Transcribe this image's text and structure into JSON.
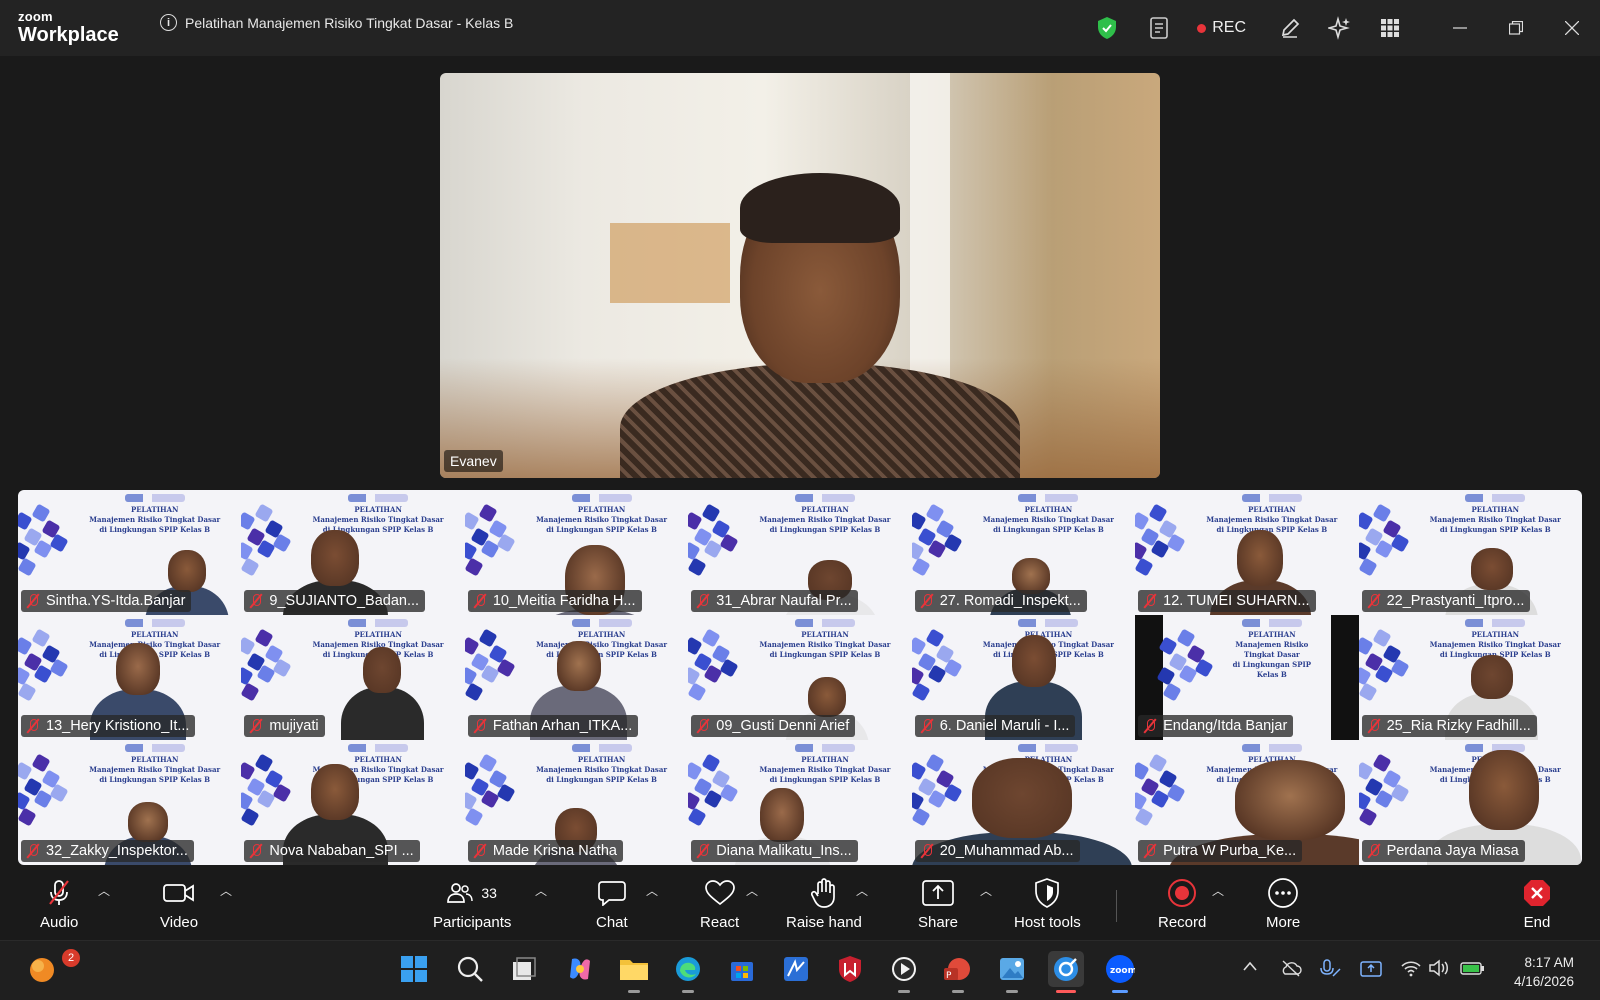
{
  "app": {
    "logo_line1": "zoom",
    "logo_line2": "Workplace",
    "meeting_title": "Pelatihan Manajemen Risiko Tingkat Dasar - Kelas B",
    "rec_label": "REC"
  },
  "speaker": {
    "name": "Evanev"
  },
  "banner": {
    "line1": "PELATIHAN",
    "line2": "Manajemen Risiko Tingkat Dasar",
    "line3": "di Lingkungan SPIP Kelas B"
  },
  "gallery": [
    {
      "name": "Sintha.YS-Itda.Banjar"
    },
    {
      "name": "9_SUJIANTO_Badan..."
    },
    {
      "name": "10_Meitia Faridha H..."
    },
    {
      "name": "31_Abrar Naufal Pr..."
    },
    {
      "name": "27. Romadi_Inspekt..."
    },
    {
      "name": "12. TUMEI SUHARN..."
    },
    {
      "name": "22_Prastyanti_Itpro..."
    },
    {
      "name": "13_Hery Kristiono_It..."
    },
    {
      "name": "mujiyati"
    },
    {
      "name": "Fathan Arhan_ITKA..."
    },
    {
      "name": "09_Gusti Denni Arief"
    },
    {
      "name": "6. Daniel Maruli - I..."
    },
    {
      "name": "Endang/Itda Banjar"
    },
    {
      "name": "25_Ria Rizky Fadhill..."
    },
    {
      "name": "32_Zakky_Inspektor..."
    },
    {
      "name": "Nova Nababan_SPI ..."
    },
    {
      "name": "Made Krisna Natha"
    },
    {
      "name": "Diana Malikatu_Ins..."
    },
    {
      "name": "20_Muhammad Ab..."
    },
    {
      "name": "Putra W Purba_Ke..."
    },
    {
      "name": "Perdana Jaya Miasa"
    }
  ],
  "controls": {
    "audio": "Audio",
    "video": "Video",
    "participants": "Participants",
    "participants_count": "33",
    "chat": "Chat",
    "react": "React",
    "raise_hand": "Raise hand",
    "share": "Share",
    "host_tools": "Host tools",
    "record": "Record",
    "more": "More",
    "end": "End"
  },
  "taskbar": {
    "notification_count": "2",
    "time": "8:17 AM",
    "date": "4/16/2026"
  },
  "colors": {
    "rec_red": "#e8343a",
    "shield_green": "#2fbf4a",
    "zoom_blue": "#0b5cff",
    "end_red": "#e0242e"
  }
}
